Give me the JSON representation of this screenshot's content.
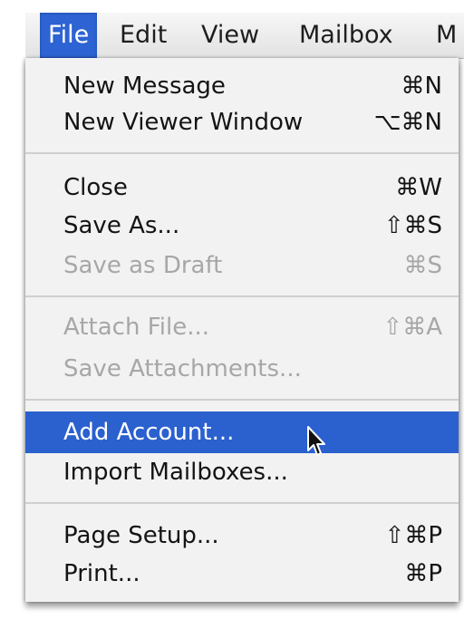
{
  "menubar": {
    "items": [
      "File",
      "Edit",
      "View",
      "Mailbox",
      "M"
    ]
  },
  "file_menu": {
    "groups": [
      [
        {
          "label": "New Message",
          "shortcut": "⌘N",
          "enabled": true
        },
        {
          "label": "New Viewer Window",
          "shortcut": "⌥⌘N",
          "enabled": true
        }
      ],
      [
        {
          "label": "Close",
          "shortcut": "⌘W",
          "enabled": true
        },
        {
          "label": "Save As...",
          "shortcut": "⇧⌘S",
          "enabled": true
        },
        {
          "label": "Save as Draft",
          "shortcut": "⌘S",
          "enabled": false
        }
      ],
      [
        {
          "label": "Attach File...",
          "shortcut": "⇧⌘A",
          "enabled": false
        },
        {
          "label": "Save Attachments...",
          "shortcut": "",
          "enabled": false
        }
      ],
      [
        {
          "label": "Add Account...",
          "shortcut": "",
          "enabled": true,
          "highlighted": true
        },
        {
          "label": "Import Mailboxes...",
          "shortcut": "",
          "enabled": true
        }
      ],
      [
        {
          "label": "Page Setup...",
          "shortcut": "⇧⌘P",
          "enabled": true
        },
        {
          "label": "Print...",
          "shortcut": "⌘P",
          "enabled": true
        }
      ]
    ]
  },
  "colors": {
    "selection": "#2b60cf",
    "menu_background": "#f2f2f2",
    "disabled_text": "#a7a7a7"
  }
}
